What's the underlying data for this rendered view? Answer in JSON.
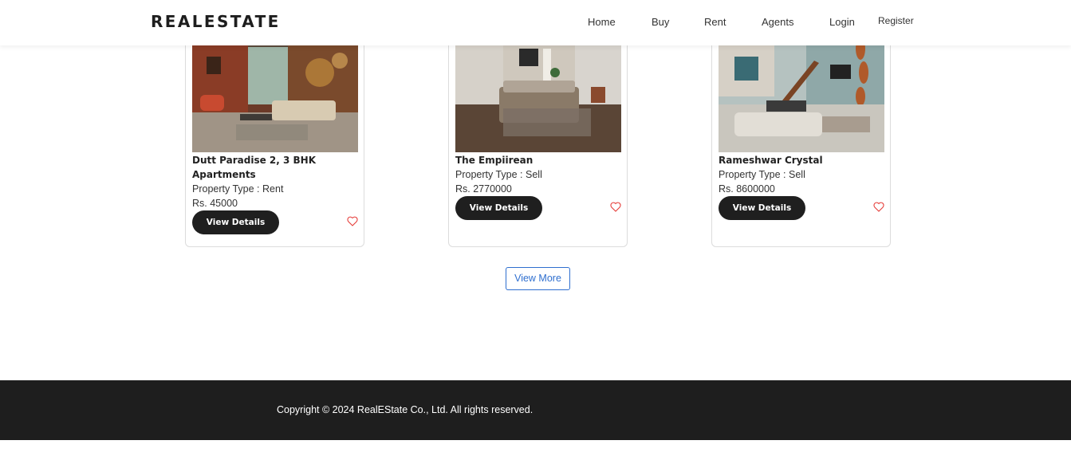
{
  "header": {
    "brand": "REALESTATE",
    "nav": {
      "home": "Home",
      "buy": "Buy",
      "rent": "Rent",
      "agents": "Agents",
      "login": "Login",
      "register": "Register"
    }
  },
  "listings": [
    {
      "title": "Dutt Paradise 2, 3 BHK Apartments",
      "property_type": "Property Type : Rent",
      "price": "Rs. 45000",
      "button_label": "View Details",
      "image_alt": "living-room-photo"
    },
    {
      "title": "The Empiirean",
      "property_type": "Property Type : Sell",
      "price": "Rs. 2770000",
      "button_label": "View Details",
      "image_alt": "bedroom-photo"
    },
    {
      "title": "Rameshwar Crystal",
      "property_type": "Property Type : Sell",
      "price": "Rs. 8600000",
      "button_label": "View Details",
      "image_alt": "duplex-living-room-photo"
    }
  ],
  "view_more_label": "View More",
  "footer": {
    "copyright": "Copyright © 2024 RealEState Co., Ltd. All rights reserved."
  },
  "colors": {
    "accent": "#2f6fcf",
    "button_dark": "#1f1f1f",
    "footer_bg": "#1e1e1e",
    "heart": "#e53935"
  },
  "icons": {
    "favorite": "heart-outline-icon"
  }
}
